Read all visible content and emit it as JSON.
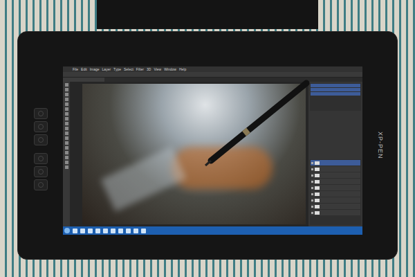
{
  "device": {
    "brand": "XP-PEN"
  },
  "app": {
    "menu": [
      "File",
      "Edit",
      "Image",
      "Layer",
      "Type",
      "Select",
      "Filter",
      "3D",
      "View",
      "Window",
      "Help"
    ]
  }
}
